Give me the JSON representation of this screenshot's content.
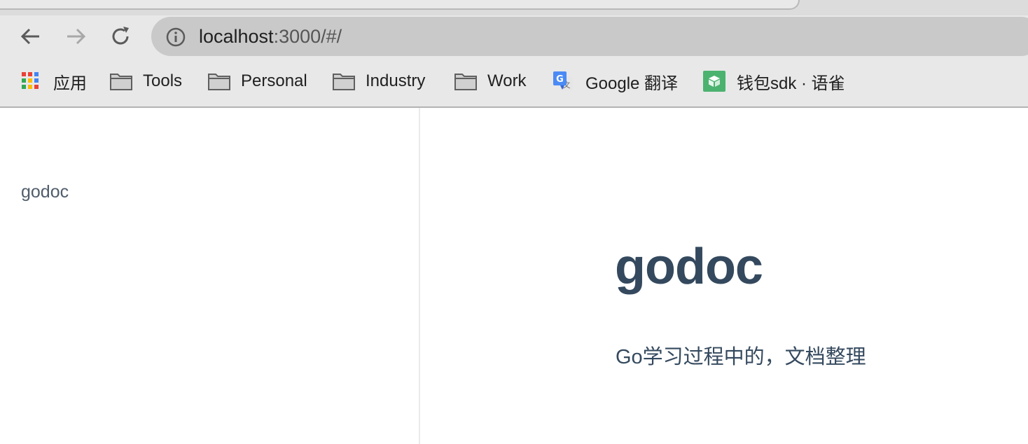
{
  "browser": {
    "url_host": "localhost",
    "url_path": ":3000/#/",
    "bookmarks": [
      {
        "label": "应用",
        "icon": "apps-grid-icon"
      },
      {
        "label": "Tools",
        "icon": "folder-icon"
      },
      {
        "label": "Personal",
        "icon": "folder-icon"
      },
      {
        "label": "Industry",
        "icon": "folder-icon"
      },
      {
        "label": "Work",
        "icon": "folder-icon"
      },
      {
        "label": "Google 翻译",
        "icon": "google-translate-icon"
      },
      {
        "label": "钱包sdk · 语雀",
        "icon": "yuque-icon"
      }
    ]
  },
  "sidebar": {
    "link": "godoc"
  },
  "cover": {
    "title": "godoc",
    "description": "Go学习过程中的，文档整理"
  },
  "colors": {
    "text_primary": "#34495e",
    "sidebar_text": "#505d6b",
    "omnibox": "#c9c9c9",
    "toolbar": "#e8e8e8"
  }
}
